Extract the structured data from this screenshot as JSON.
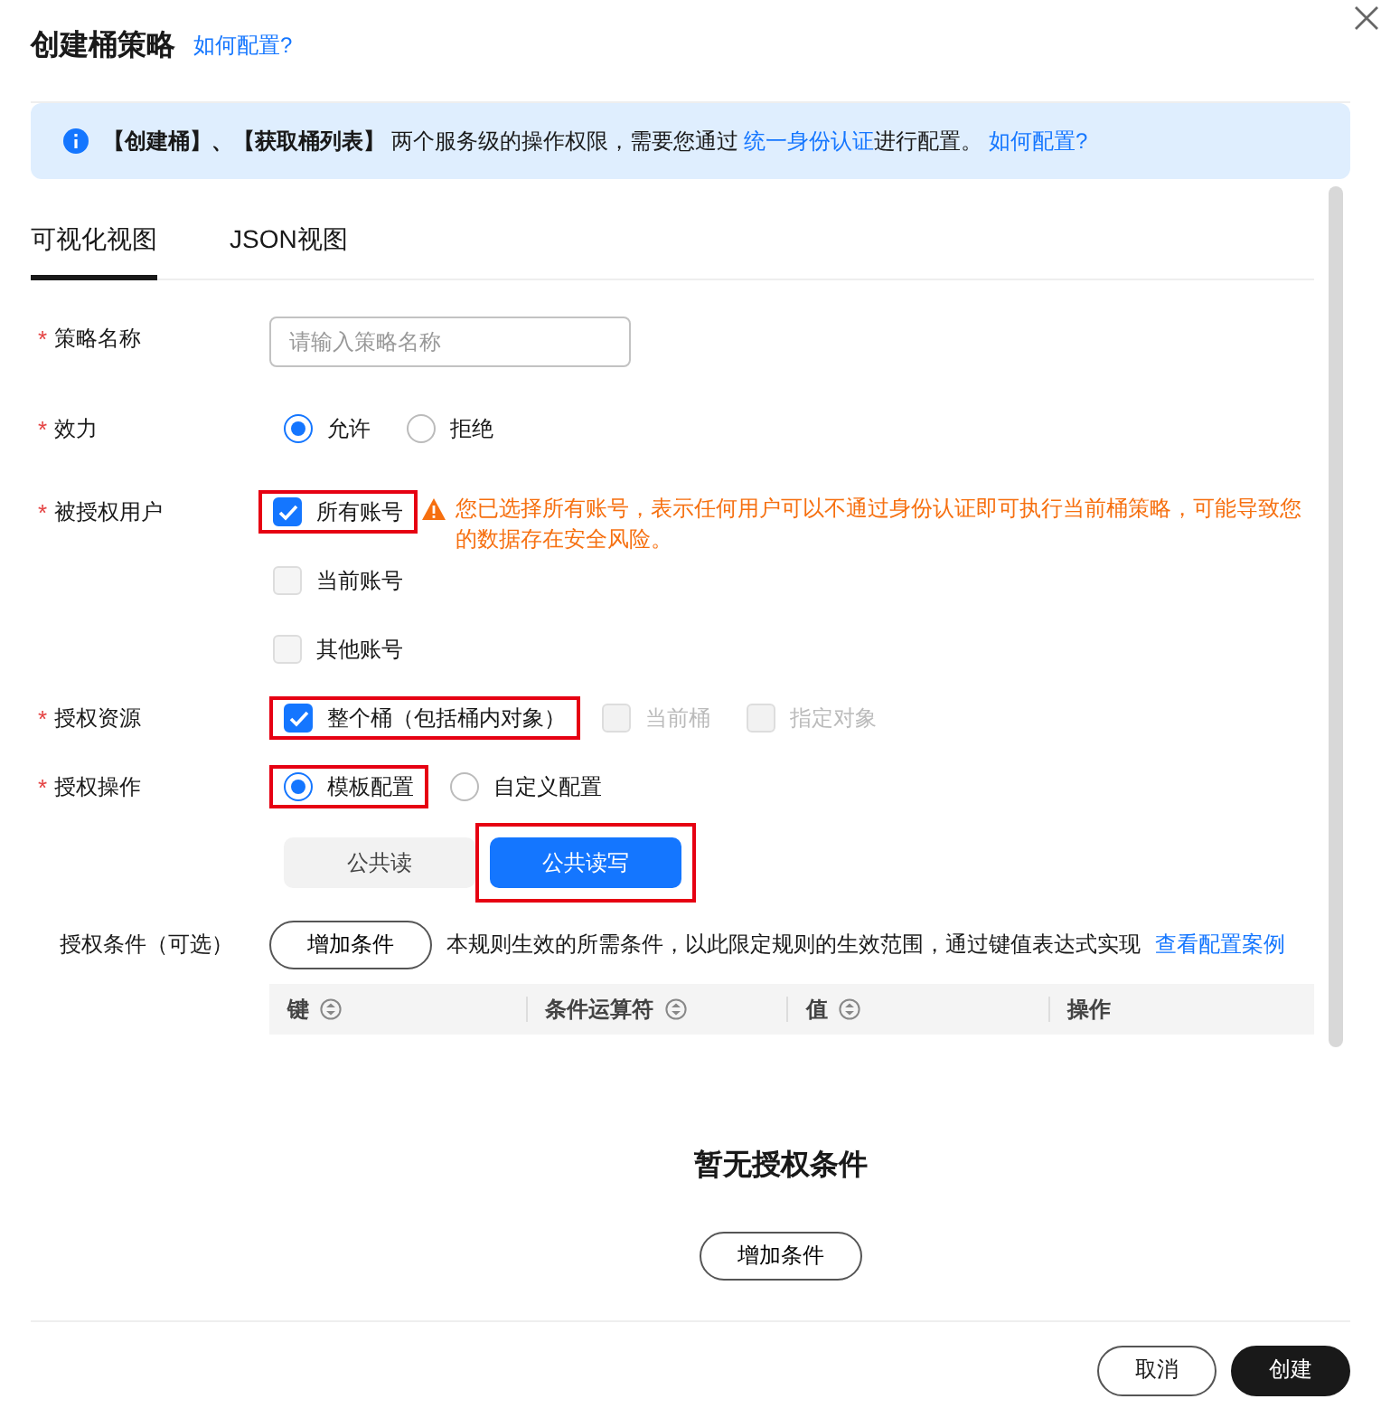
{
  "dialog": {
    "title": "创建桶策略",
    "help_link": "如何配置?"
  },
  "notice": {
    "segments": [
      {
        "kind": "bold",
        "text": "【创建桶】、【获取桶列表】"
      },
      {
        "kind": "text",
        "text": " 两个服务级的操作权限，需要您通过 "
      },
      {
        "kind": "link",
        "text": "统一身份认证"
      },
      {
        "kind": "text",
        "text": "进行配置。 "
      },
      {
        "kind": "link",
        "text": "如何配置?"
      }
    ]
  },
  "tabs": [
    {
      "label": "可视化视图",
      "selected": true
    },
    {
      "label": "JSON视图",
      "selected": false
    }
  ],
  "fields": [
    {
      "kind": "input",
      "label": "策略名称",
      "required_mark": "*",
      "placeholder": "请输入策略名称"
    },
    {
      "kind": "radio",
      "label": "效力",
      "required_mark": "*",
      "options": [
        {
          "label": "允许",
          "selected": true,
          "highlighted": false
        },
        {
          "label": "拒绝",
          "selected": false,
          "highlighted": false
        }
      ]
    },
    {
      "kind": "checkbox_stack",
      "label": "被授权用户",
      "required_mark": "*",
      "warning": "您已选择所有账号，表示任何用户可以不通过身份认证即可执行当前桶策略，可能导致您的数据存在安全风险。",
      "options": [
        {
          "label": "所有账号",
          "checked": true,
          "disabled": false,
          "highlighted": true
        },
        {
          "label": "当前账号",
          "checked": false,
          "disabled": false,
          "highlighted": false
        },
        {
          "label": "其他账号",
          "checked": false,
          "disabled": false,
          "highlighted": false
        }
      ]
    },
    {
      "kind": "checkbox_row",
      "label": "授权资源",
      "required_mark": "*",
      "options": [
        {
          "label": "整个桶（包括桶内对象）",
          "checked": true,
          "disabled": false,
          "highlighted": true
        },
        {
          "label": "当前桶",
          "checked": false,
          "disabled": true,
          "highlighted": false
        },
        {
          "label": "指定对象",
          "checked": false,
          "disabled": true,
          "highlighted": false
        }
      ]
    },
    {
      "kind": "radio",
      "label": "授权操作",
      "required_mark": "*",
      "options": [
        {
          "label": "模板配置",
          "selected": true,
          "highlighted": true
        },
        {
          "label": "自定义配置",
          "selected": false,
          "highlighted": false
        }
      ],
      "templates": [
        {
          "label": "公共读",
          "selected": false,
          "highlighted": false
        },
        {
          "label": "公共读写",
          "selected": true,
          "highlighted": true
        }
      ]
    }
  ],
  "conditions": {
    "label": "授权条件（可选）",
    "add_button": "增加条件",
    "description": "本规则生效的所需条件，以此限定规则的生效范围，通过键值表达式实现",
    "link": "查看配置案例",
    "columns": [
      {
        "label": "键",
        "sortable": true
      },
      {
        "label": "条件运算符",
        "sortable": true
      },
      {
        "label": "值",
        "sortable": true
      },
      {
        "label": "操作",
        "sortable": false
      }
    ],
    "empty_text": "暂无授权条件",
    "empty_button": "增加条件"
  },
  "footer": {
    "buttons": [
      {
        "label": "取消",
        "kind": "secondary"
      },
      {
        "label": "创建",
        "kind": "primary"
      }
    ]
  }
}
